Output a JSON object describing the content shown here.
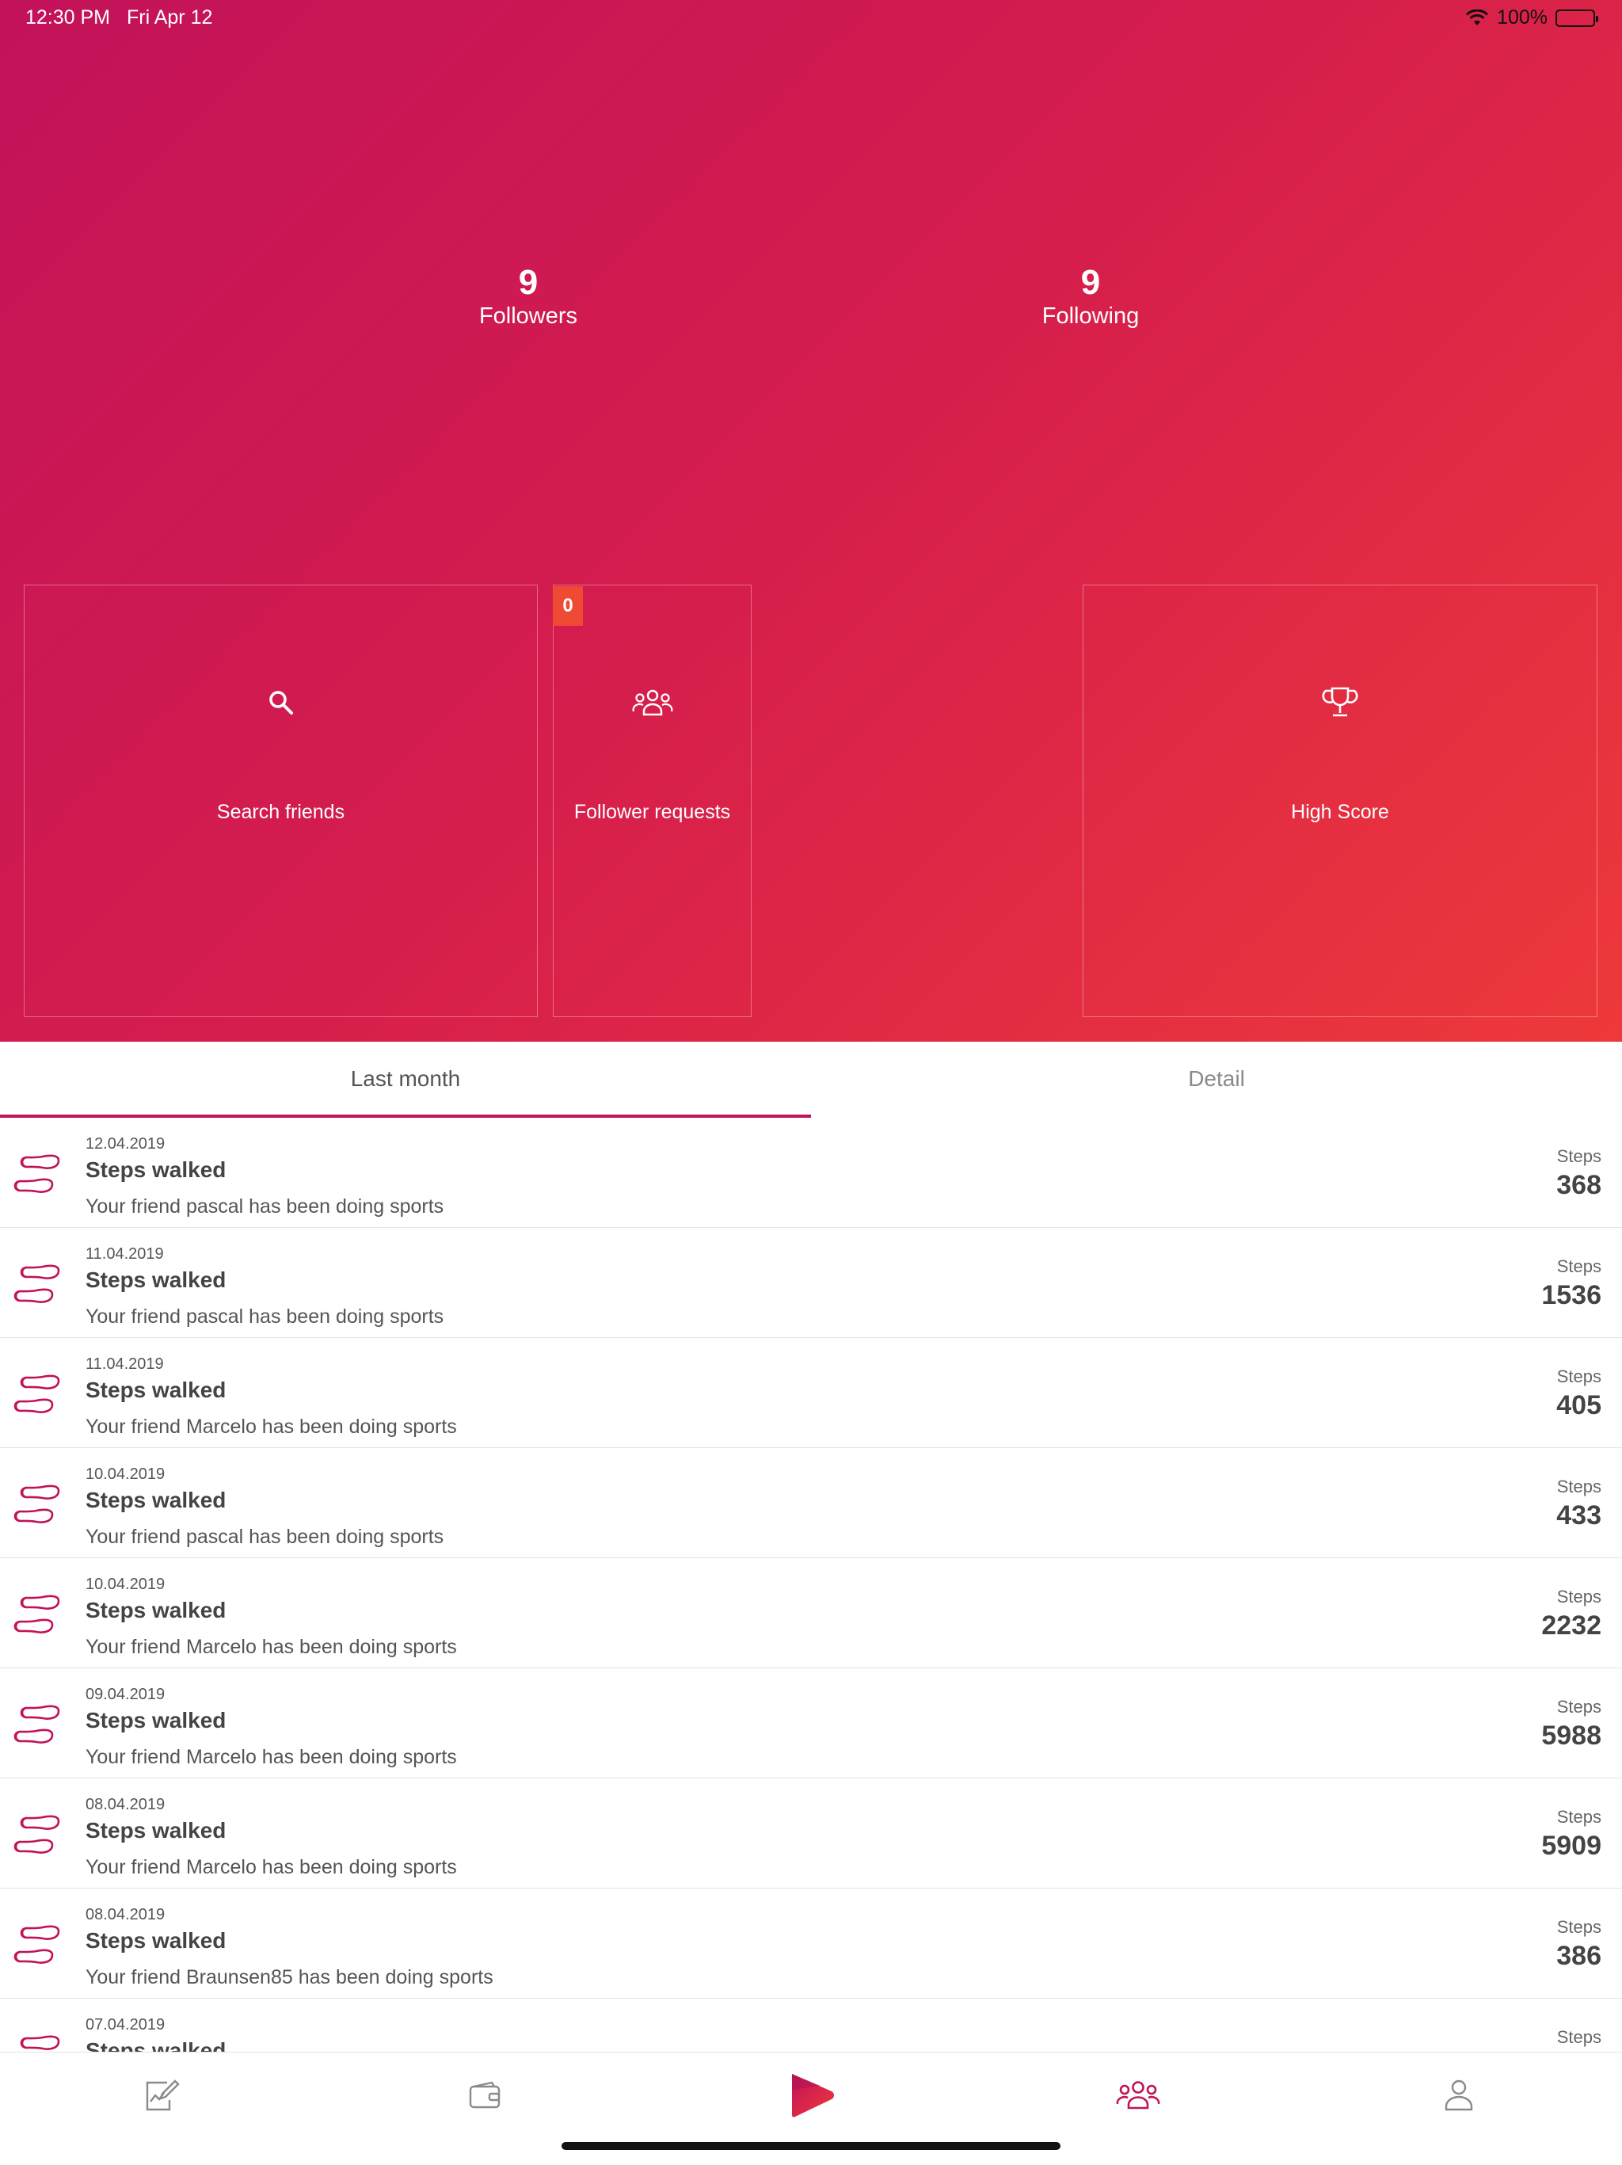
{
  "status_bar": {
    "time": "12:30 PM",
    "date": "Fri Apr 12",
    "battery": "100%"
  },
  "stats": {
    "followers": {
      "count": "9",
      "label": "Followers"
    },
    "following": {
      "count": "9",
      "label": "Following"
    }
  },
  "tiles": {
    "search": {
      "label": "Search friends",
      "icon": "search-icon"
    },
    "requests": {
      "label": "Follower requests",
      "icon": "people-icon",
      "badge": "0"
    },
    "highscore": {
      "label": "High Score",
      "icon": "trophy-icon"
    }
  },
  "tabs": {
    "last_month": "Last month",
    "detail": "Detail",
    "active": "last_month"
  },
  "feed": {
    "items": [
      {
        "date": "12.04.2019",
        "title": "Steps walked",
        "desc": "Your friend pascal has been doing sports",
        "steps_label": "Steps",
        "steps": "368"
      },
      {
        "date": "11.04.2019",
        "title": "Steps walked",
        "desc": "Your friend pascal has been doing sports",
        "steps_label": "Steps",
        "steps": "1536"
      },
      {
        "date": "11.04.2019",
        "title": "Steps walked",
        "desc": "Your friend Marcelo has been doing sports",
        "steps_label": "Steps",
        "steps": "405"
      },
      {
        "date": "10.04.2019",
        "title": "Steps walked",
        "desc": "Your friend pascal has been doing sports",
        "steps_label": "Steps",
        "steps": "433"
      },
      {
        "date": "10.04.2019",
        "title": "Steps walked",
        "desc": "Your friend Marcelo has been doing sports",
        "steps_label": "Steps",
        "steps": "2232"
      },
      {
        "date": "09.04.2019",
        "title": "Steps walked",
        "desc": "Your friend Marcelo has been doing sports",
        "steps_label": "Steps",
        "steps": "5988"
      },
      {
        "date": "08.04.2019",
        "title": "Steps walked",
        "desc": "Your friend Marcelo has been doing sports",
        "steps_label": "Steps",
        "steps": "5909"
      },
      {
        "date": "08.04.2019",
        "title": "Steps walked",
        "desc": "Your friend Braunsen85 has been doing sports",
        "steps_label": "Steps",
        "steps": "386"
      },
      {
        "date": "07.04.2019",
        "title": "Steps walked",
        "desc": "",
        "steps_label": "Steps",
        "steps": ""
      }
    ]
  },
  "tabbar": {
    "items": [
      {
        "icon": "activity-log-icon"
      },
      {
        "icon": "wallet-icon"
      },
      {
        "icon": "app-logo-icon"
      },
      {
        "icon": "friends-icon",
        "active": true
      },
      {
        "icon": "profile-icon"
      }
    ]
  },
  "colors": {
    "gradient_start": "#c2125a",
    "gradient_end": "#ee393a",
    "accent": "#c2125a",
    "badge": "#ee4a34"
  }
}
